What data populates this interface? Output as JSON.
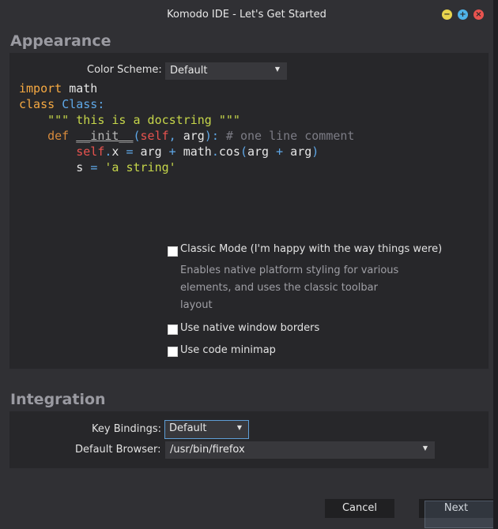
{
  "window": {
    "title": "Komodo IDE - Let's Get Started"
  },
  "appearance": {
    "section_title": "Appearance",
    "color_scheme_label": "Color Scheme:",
    "color_scheme_value": "Default",
    "code_lines": [
      "import math",
      "class Class:",
      "\"\"\" this is a docstring \"\"\"",
      "def __init__(self, arg): # one line comment",
      "self.x = arg + math.cos(arg + arg)",
      "s = 'a string'"
    ],
    "classic_mode_label": "Classic Mode (I'm happy with the way things were)",
    "classic_mode_desc": [
      "Enables native platform styling for various",
      "elements, and uses the classic toolbar",
      "layout"
    ],
    "native_borders_label": "Use native window borders",
    "code_minimap_label": "Use code minimap"
  },
  "integration": {
    "section_title": "Integration",
    "key_bindings_label": "Key Bindings:",
    "key_bindings_value": "Default",
    "default_browser_label": "Default Browser:",
    "default_browser_value": "/usr/bin/firefox"
  },
  "footer": {
    "cancel_label": "Cancel",
    "next_label": "Next"
  },
  "icons": {
    "minimize": "minimize-icon",
    "maximize": "maximize-icon",
    "close": "close-icon",
    "dropdown": "chevron-down-icon"
  },
  "colors": {
    "background": "#303034",
    "panel": "#27272a",
    "keyword": "#f6a942",
    "class_name": "#5fa8e8",
    "string": "#c6d64a",
    "comment": "#7c7c85",
    "self": "#e8534f",
    "focus_border": "#5f9ed6"
  },
  "checkboxes": {
    "classic_mode": false,
    "native_window_borders": false,
    "code_minimap": false
  }
}
